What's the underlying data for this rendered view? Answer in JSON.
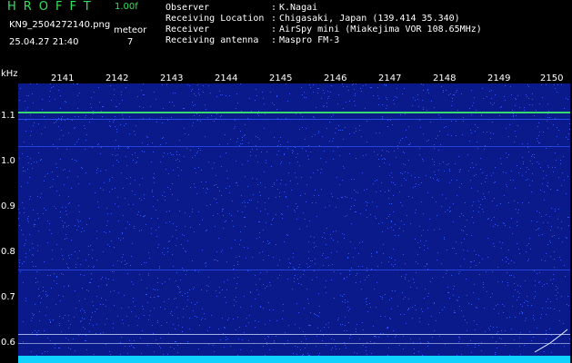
{
  "header": {
    "app_title": "HROFFT",
    "version": "1.00f",
    "filename": "KN9_2504272140.png",
    "datetime": "25.04.27 21:40",
    "meteor_label": "meteor",
    "meteor_count": "7",
    "info": [
      {
        "label": "Observer",
        "value": "K.Nagai"
      },
      {
        "label": "Receiving Location",
        "value": "Chigasaki, Japan (139.414 35.340)"
      },
      {
        "label": "Receiver",
        "value": "AirSpy mini (Miakejima VOR 108.65MHz)"
      },
      {
        "label": "Receiving antenna",
        "value": "Maspro FM-3"
      }
    ]
  },
  "spectrogram": {
    "y_unit": "kHz",
    "y_ticks": [
      "1.1",
      "1.0",
      "0.9",
      "0.8",
      "0.7",
      "0.6"
    ],
    "x_ticks": [
      "2141",
      "2142",
      "2143",
      "2144",
      "2145",
      "2146",
      "2147",
      "2148",
      "2149",
      "2150"
    ],
    "colors": {
      "background": "#0a1a8a",
      "noise": "#2f55ff",
      "signal": "#3ce06a",
      "floor": "#0fd2ff"
    }
  }
}
